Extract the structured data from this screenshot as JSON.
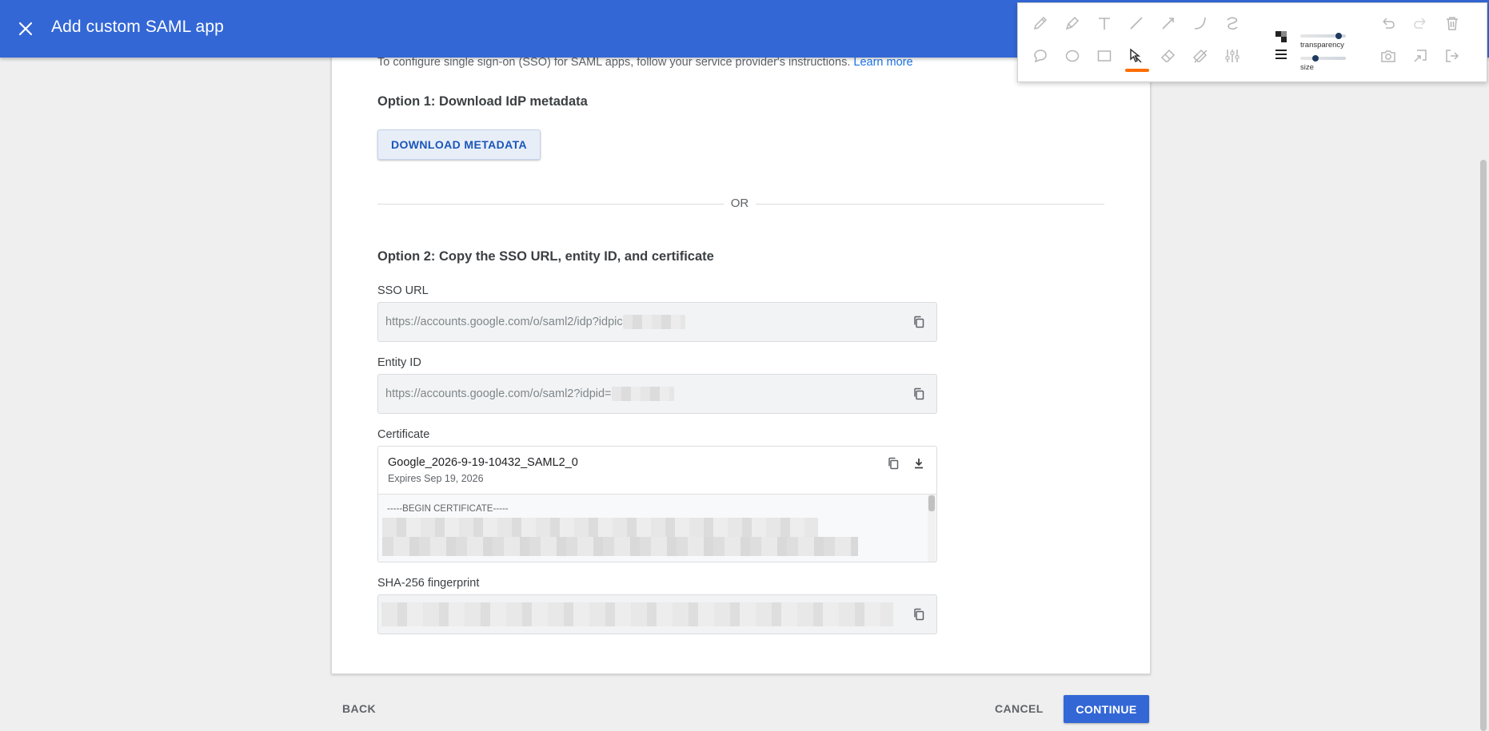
{
  "header": {
    "title": "Add custom SAML app",
    "close_icon": "close-icon"
  },
  "content": {
    "intro_text": "To configure single sign-on (SSO) for SAML apps, follow your service provider's instructions.",
    "learn_more": "Learn more",
    "option1_title": "Option 1: Download IdP metadata",
    "download_button": "DOWNLOAD METADATA",
    "or_text": "OR",
    "option2_title": "Option 2: Copy the SSO URL, entity ID, and certificate",
    "sso_label": "SSO URL",
    "sso_value": "https://accounts.google.com/o/saml2/idp?idpic",
    "entity_label": "Entity ID",
    "entity_value": "https://accounts.google.com/o/saml2?idpid=",
    "certificate_label": "Certificate",
    "cert_name": "Google_2026-9-19-10432_SAML2_0",
    "cert_expires": "Expires Sep 19, 2026",
    "cert_begin": "-----BEGIN CERTIFICATE-----",
    "sha_label": "SHA-256 fingerprint"
  },
  "footer": {
    "back": "BACK",
    "cancel": "CANCEL",
    "continue": "CONTINUE"
  },
  "toolbar": {
    "transparency_label": "transparency",
    "size_label": "size",
    "selected_color": "#1a00f5",
    "active_tool": "select-arrow",
    "accent_color": "#ff6d00",
    "transparency_level": 0.85,
    "size_level": 0.33
  },
  "colors": {
    "header": "#3367d6",
    "link": "#1a73e8",
    "primary_button": "#3367d6"
  }
}
